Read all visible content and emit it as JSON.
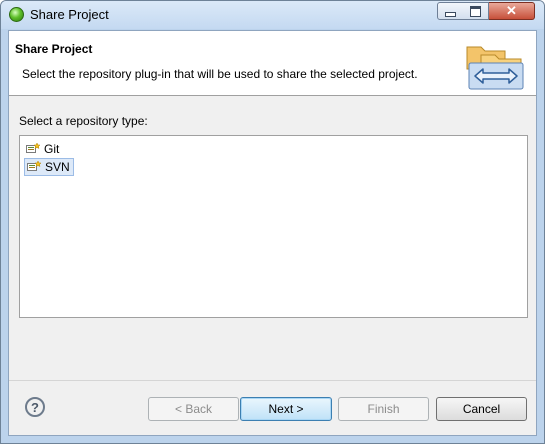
{
  "window": {
    "title": "Share Project",
    "icons": {
      "app": "eclipse-icon",
      "minimize": "minimize-icon",
      "maximize": "maximize-icon",
      "close": "close-icon"
    },
    "close_glyph": "✕"
  },
  "header": {
    "title": "Share Project",
    "description": "Select the repository plug-in that will be used to share the selected project.",
    "image": "share-folders-icon"
  },
  "repository_list": {
    "label": "Select a repository type:",
    "items": [
      {
        "label": "Git",
        "icon": "git-repository-icon",
        "selected": false
      },
      {
        "label": "SVN",
        "icon": "svn-repository-icon",
        "selected": true
      }
    ]
  },
  "footer": {
    "help_glyph": "?",
    "help_icon": "help-icon",
    "buttons": {
      "back": {
        "label": "< Back",
        "enabled": false
      },
      "next": {
        "label": "Next >",
        "enabled": true,
        "default": true
      },
      "finish": {
        "label": "Finish",
        "enabled": false
      },
      "cancel": {
        "label": "Cancel",
        "enabled": true
      }
    }
  },
  "colors": {
    "selection": "#dde9f8",
    "selection_border": "#9cbce6",
    "titlebar": "#c4d9f1",
    "close": "#c7503a"
  }
}
